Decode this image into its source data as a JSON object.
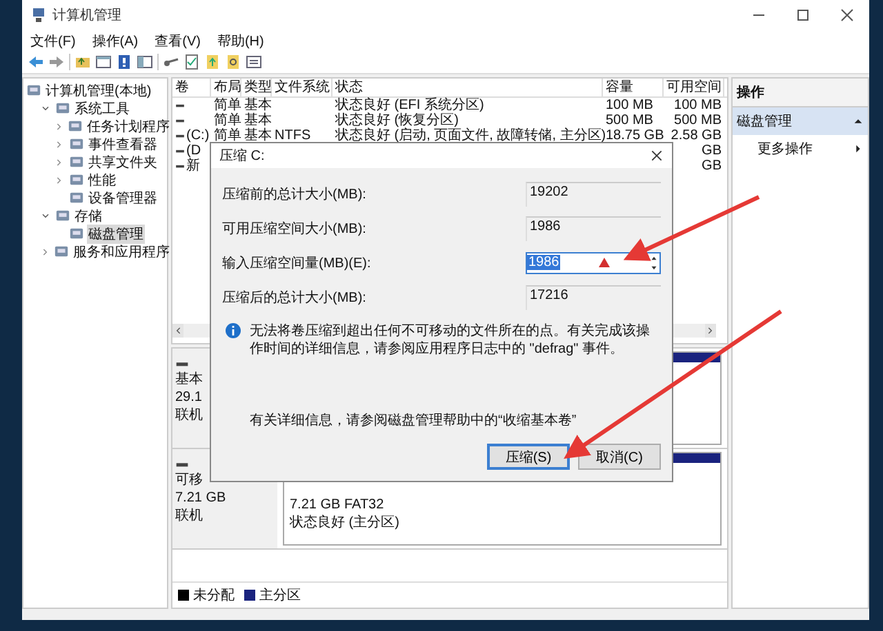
{
  "window": {
    "title": "计算机管理"
  },
  "menu": [
    "文件(F)",
    "操作(A)",
    "查看(V)",
    "帮助(H)"
  ],
  "tree": [
    {
      "label": "计算机管理(本地)",
      "kind": "root",
      "expanded": true,
      "selected": false,
      "children": [
        {
          "label": "系统工具",
          "kind": "expandable",
          "expanded": true,
          "selected": false,
          "children": [
            {
              "label": "任务计划程序",
              "kind": "expandable",
              "expanded": false,
              "selected": false
            },
            {
              "label": "事件查看器",
              "kind": "expandable",
              "expanded": false,
              "selected": false
            },
            {
              "label": "共享文件夹",
              "kind": "expandable",
              "expanded": false,
              "selected": false
            },
            {
              "label": "性能",
              "kind": "expandable",
              "expanded": false,
              "selected": false
            },
            {
              "label": "设备管理器",
              "kind": "leaf",
              "expanded": false,
              "selected": false
            }
          ]
        },
        {
          "label": "存储",
          "kind": "expandable",
          "expanded": true,
          "selected": false,
          "children": [
            {
              "label": "磁盘管理",
              "kind": "leaf",
              "expanded": false,
              "selected": true
            }
          ]
        },
        {
          "label": "服务和应用程序",
          "kind": "expandable",
          "expanded": false,
          "selected": false
        }
      ]
    }
  ],
  "table": {
    "columns": [
      "卷",
      "布局",
      "类型",
      "文件系统",
      "状态",
      "容量",
      "可用空间"
    ],
    "rows": [
      {
        "volume": "",
        "layout": "简单",
        "type": "基本",
        "fs": "",
        "status": "状态良好 (EFI 系统分区)",
        "capacity": "100 MB",
        "free": "100 MB"
      },
      {
        "volume": "",
        "layout": "简单",
        "type": "基本",
        "fs": "",
        "status": "状态良好 (恢复分区)",
        "capacity": "500 MB",
        "free": "500 MB"
      },
      {
        "volume": "(C:)",
        "layout": "简单",
        "type": "基本",
        "fs": "NTFS",
        "status": "状态良好 (启动, 页面文件, 故障转储, 主分区)",
        "capacity": "18.75 GB",
        "free": "2.58 GB"
      },
      {
        "volume": "(D",
        "layout": "",
        "type": "",
        "fs": "",
        "status": "",
        "capacity": "",
        "free": "GB"
      },
      {
        "volume": "新",
        "layout": "",
        "type": "",
        "fs": "",
        "status": "",
        "capacity": "",
        "free": "GB"
      }
    ]
  },
  "disks": [
    {
      "lines": [
        "基本",
        "29.1",
        "联机"
      ],
      "partitions": [
        {
          "kind": "primary"
        }
      ]
    },
    {
      "lines": [
        "可移",
        "7.21 GB",
        "联机"
      ],
      "partitions": [
        {
          "kind": "primary",
          "lines": [
            "7.21 GB FAT32",
            "状态良好 (主分区)"
          ]
        }
      ]
    }
  ],
  "legend": [
    {
      "label": "未分配",
      "color": "#000000"
    },
    {
      "label": "主分区",
      "color": "#1a237e"
    }
  ],
  "actions": {
    "title": "操作",
    "section": "磁盘管理",
    "items": [
      "更多操作"
    ]
  },
  "dialog": {
    "title": "压缩 C:",
    "fields": [
      {
        "label": "压缩前的总计大小(MB):",
        "value": "19202",
        "editable": false
      },
      {
        "label": "可用压缩空间大小(MB):",
        "value": "1986",
        "editable": false
      },
      {
        "label": "输入压缩空间量(MB)(E):",
        "value": "1986",
        "editable": true
      },
      {
        "label": "压缩后的总计大小(MB):",
        "value": "17216",
        "editable": false
      }
    ],
    "info": "无法将卷压缩到超出任何不可移动的文件所在的点。有关完成该操作时间的详细信息，请参阅应用程序日志中的 \"defrag\" 事件。",
    "help": "有关详细信息，请参阅磁盘管理帮助中的“收缩基本卷”",
    "buttons": [
      {
        "label": "压缩(S)",
        "default": true
      },
      {
        "label": "取消(C)",
        "default": false
      }
    ]
  }
}
